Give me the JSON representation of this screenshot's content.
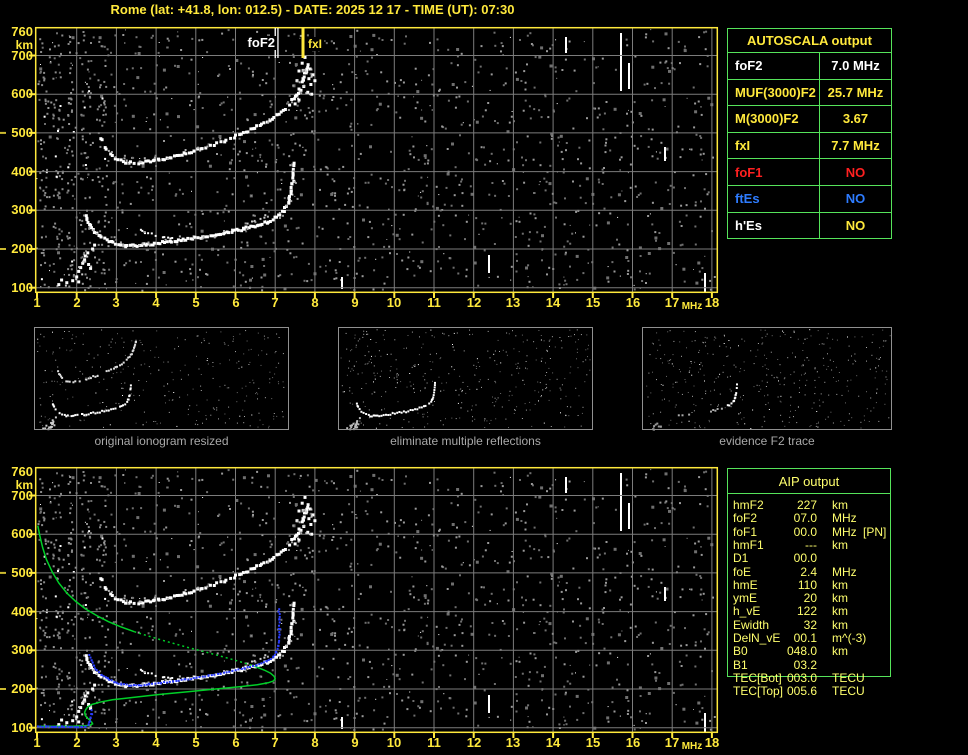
{
  "title": "Rome (lat: +41.8, lon: 012.5) - DATE: 2025 12 17 - TIME (UT): 07:30",
  "colors": {
    "background": "#000000",
    "yellow": "#FFE93C",
    "pale_yellow": "#FFFF6E",
    "white": "#FFFFFF",
    "red": "#FF2020",
    "blue": "#2E7CFF",
    "trace_blue": "#2A3CFF",
    "profile_green": "#00D028",
    "table_green": "#55E35A",
    "grid_gray": "#7C7C7C",
    "thumb_border_gray": "#909090",
    "caption_gray": "#A8A8A8"
  },
  "chart_data": {
    "type": "scatter",
    "title": "Ionogram, Rome, 2025 12 17 07:30 UT",
    "xlabel": "MHz",
    "ylabel": "km",
    "xlim": [
      1,
      18
    ],
    "ylim": [
      100,
      760
    ],
    "axes": {
      "x_ticks": [
        "1",
        "2",
        "3",
        "4",
        "5",
        "6",
        "7",
        "8",
        "9",
        "10",
        "11",
        "12",
        "13",
        "14",
        "15",
        "16",
        "17",
        "18"
      ],
      "x_unit": "MHz",
      "y_ticks": [
        "760",
        "700",
        "600",
        "500",
        "400",
        "300",
        "200",
        "100"
      ],
      "y_unit": "km"
    },
    "markers": [
      {
        "name": "foF2",
        "label": "foF2",
        "freq": 7.0,
        "color": "white"
      },
      {
        "name": "fxI",
        "label": "fxI",
        "freq": 7.7,
        "color": "yellow"
      }
    ],
    "series": {
      "first_hop": [
        [
          2.2,
          287
        ],
        [
          2.28,
          268
        ],
        [
          2.38,
          252
        ],
        [
          2.5,
          240
        ],
        [
          2.65,
          230
        ],
        [
          2.82,
          222
        ],
        [
          3.0,
          216
        ],
        [
          3.2,
          213
        ],
        [
          3.45,
          213
        ],
        [
          3.7,
          215
        ],
        [
          4.0,
          219
        ],
        [
          4.3,
          223
        ],
        [
          4.6,
          227
        ],
        [
          4.9,
          231
        ],
        [
          5.2,
          236
        ],
        [
          5.5,
          241
        ],
        [
          5.8,
          247
        ],
        [
          6.1,
          254
        ],
        [
          6.4,
          262
        ],
        [
          6.7,
          271
        ],
        [
          6.9,
          280
        ],
        [
          7.05,
          290
        ],
        [
          7.18,
          303
        ],
        [
          7.28,
          320
        ],
        [
          7.35,
          345
        ],
        [
          7.4,
          375
        ],
        [
          7.43,
          405
        ],
        [
          7.45,
          430
        ]
      ],
      "first_hop_cusp": [
        [
          3.5,
          253
        ],
        [
          3.7,
          246
        ],
        [
          3.95,
          239
        ],
        [
          4.2,
          234
        ],
        [
          4.45,
          230
        ]
      ],
      "inner_branch": [
        [
          6.05,
          262
        ],
        [
          6.3,
          270
        ],
        [
          6.55,
          278
        ],
        [
          6.75,
          287
        ],
        [
          6.9,
          295
        ]
      ],
      "second_hop": [
        [
          2.55,
          492
        ],
        [
          2.68,
          465
        ],
        [
          2.82,
          448
        ],
        [
          3.0,
          435
        ],
        [
          3.2,
          428
        ],
        [
          3.45,
          426
        ],
        [
          3.7,
          428
        ],
        [
          4.0,
          433
        ],
        [
          4.3,
          440
        ],
        [
          4.6,
          448
        ],
        [
          4.9,
          457
        ],
        [
          5.2,
          466
        ],
        [
          5.5,
          476
        ],
        [
          5.8,
          488
        ],
        [
          6.1,
          500
        ],
        [
          6.4,
          514
        ],
        [
          6.7,
          530
        ],
        [
          6.95,
          546
        ],
        [
          7.15,
          562
        ],
        [
          7.35,
          582
        ],
        [
          7.5,
          602
        ],
        [
          7.6,
          622
        ],
        [
          7.68,
          645
        ],
        [
          7.75,
          668
        ],
        [
          7.8,
          688
        ]
      ],
      "spread_f": [
        [
          7.5,
          575
        ],
        [
          7.55,
          598
        ],
        [
          7.6,
          585
        ],
        [
          7.65,
          610
        ],
        [
          7.7,
          640
        ],
        [
          7.72,
          620
        ],
        [
          7.78,
          655
        ],
        [
          7.85,
          640
        ],
        [
          7.9,
          625
        ],
        [
          7.82,
          605
        ],
        [
          7.88,
          665
        ],
        [
          7.95,
          650
        ],
        [
          7.6,
          660
        ],
        [
          7.68,
          680
        ],
        [
          7.75,
          695
        ],
        [
          7.55,
          635
        ],
        [
          8.0,
          635
        ],
        [
          7.92,
          600
        ]
      ],
      "e_region": [
        [
          1.62,
          120
        ],
        [
          1.75,
          113
        ],
        [
          1.9,
          118
        ],
        [
          2.0,
          128
        ],
        [
          2.05,
          142
        ],
        [
          2.1,
          152
        ],
        [
          2.15,
          163
        ],
        [
          2.2,
          172
        ],
        [
          2.22,
          182
        ],
        [
          2.28,
          190
        ],
        [
          2.05,
          115
        ],
        [
          2.3,
          160
        ],
        [
          2.35,
          150
        ],
        [
          1.55,
          108
        ],
        [
          2.4,
          200
        ],
        [
          2.45,
          210
        ]
      ],
      "profile_green": [
        [
          1.02,
          622
        ],
        [
          1.07,
          596
        ],
        [
          1.14,
          566
        ],
        [
          1.24,
          534
        ],
        [
          1.38,
          503
        ],
        [
          1.55,
          474
        ],
        [
          1.75,
          448
        ],
        [
          1.98,
          426
        ],
        [
          2.22,
          407
        ],
        [
          2.5,
          390
        ],
        [
          2.8,
          374
        ],
        [
          3.1,
          361
        ],
        [
          3.45,
          348
        ],
        [
          3.8,
          337
        ],
        [
          4.15,
          326
        ],
        [
          4.5,
          316
        ],
        [
          4.85,
          306
        ],
        [
          5.2,
          297
        ],
        [
          5.55,
          287
        ],
        [
          5.9,
          277
        ],
        [
          6.2,
          268
        ],
        [
          6.5,
          258
        ],
        [
          6.72,
          249
        ],
        [
          6.88,
          241
        ],
        [
          6.97,
          233
        ],
        [
          7.0,
          227
        ],
        [
          6.96,
          221
        ],
        [
          6.82,
          216
        ],
        [
          6.55,
          211
        ],
        [
          6.1,
          206
        ],
        [
          5.5,
          200
        ],
        [
          4.8,
          193
        ],
        [
          4.1,
          186
        ],
        [
          3.4,
          178
        ],
        [
          2.9,
          172
        ],
        [
          2.58,
          166
        ],
        [
          2.38,
          160
        ],
        [
          2.28,
          154
        ],
        [
          2.23,
          147
        ],
        [
          2.2,
          139
        ],
        [
          2.22,
          131
        ],
        [
          2.27,
          125
        ],
        [
          2.33,
          119
        ],
        [
          2.38,
          114
        ],
        [
          2.4,
          110
        ],
        [
          2.33,
          106
        ],
        [
          2.2,
          105
        ],
        [
          1.9,
          104
        ],
        [
          1.5,
          104
        ],
        [
          1.0,
          104
        ]
      ],
      "restored_E_blue": [
        [
          1.0,
          105
        ],
        [
          1.2,
          105
        ],
        [
          1.4,
          105
        ],
        [
          1.6,
          105
        ],
        [
          1.8,
          104
        ],
        [
          2.0,
          104
        ],
        [
          2.1,
          105
        ],
        [
          2.2,
          106
        ],
        [
          2.27,
          110
        ],
        [
          2.3,
          118
        ],
        [
          2.33,
          128
        ],
        [
          2.35,
          138
        ],
        [
          2.36,
          148
        ]
      ],
      "restored_F_blue": [
        [
          2.3,
          291
        ],
        [
          2.34,
          277
        ],
        [
          2.4,
          263
        ],
        [
          2.48,
          251
        ],
        [
          2.6,
          240
        ],
        [
          2.75,
          230
        ],
        [
          2.92,
          221
        ],
        [
          3.1,
          215
        ],
        [
          3.3,
          212
        ],
        [
          3.55,
          212
        ],
        [
          3.8,
          215
        ],
        [
          4.1,
          218
        ],
        [
          4.4,
          222
        ],
        [
          4.7,
          227
        ],
        [
          5.0,
          232
        ],
        [
          5.3,
          237
        ],
        [
          5.6,
          243
        ],
        [
          5.9,
          249
        ],
        [
          6.2,
          256
        ],
        [
          6.5,
          264
        ],
        [
          6.75,
          274
        ],
        [
          6.92,
          285
        ],
        [
          7.0,
          298
        ],
        [
          7.05,
          315
        ],
        [
          7.07,
          335
        ],
        [
          7.08,
          358
        ],
        [
          7.08,
          382
        ],
        [
          7.07,
          410
        ]
      ]
    }
  },
  "autoscala_table": {
    "title": "AUTOSCALA output",
    "rows": [
      {
        "param": "foF2",
        "value": "7.0 MHz",
        "color": "white"
      },
      {
        "param": "MUF(3000)F2",
        "value": "25.7 MHz",
        "color": "yellow"
      },
      {
        "param": "M(3000)F2",
        "value": "3.67",
        "color": "yellow"
      },
      {
        "param": "fxI",
        "value": "7.7 MHz",
        "color": "yellow"
      },
      {
        "param": "foF1",
        "value": "NO",
        "color": "red"
      },
      {
        "param": "ftEs",
        "value": "NO",
        "color": "blue"
      },
      {
        "param": "h'Es",
        "value": "NO",
        "color": "white",
        "value_color": "yellow"
      }
    ]
  },
  "aip_table": {
    "title": "AIP output",
    "rows": [
      {
        "param": "hmF2",
        "value": "227",
        "unit": "km",
        "extra": ""
      },
      {
        "param": "foF2",
        "value": "07.0",
        "unit": "MHz",
        "extra": ""
      },
      {
        "param": "foF1",
        "value": "00.0",
        "unit": "MHz",
        "extra": "[PN]"
      },
      {
        "param": "hmF1",
        "value": "---",
        "unit": "km",
        "extra": ""
      },
      {
        "param": "D1",
        "value": "00.0",
        "unit": "",
        "extra": ""
      },
      {
        "param": "foE",
        "value": "2.4",
        "unit": "MHz",
        "extra": ""
      },
      {
        "param": "hmE",
        "value": "110",
        "unit": "km",
        "extra": ""
      },
      {
        "param": "ymE",
        "value": "20",
        "unit": "km",
        "extra": ""
      },
      {
        "param": "h_vE",
        "value": "122",
        "unit": "km",
        "extra": ""
      },
      {
        "param": "Ewidth",
        "value": "32",
        "unit": "km",
        "extra": ""
      },
      {
        "param": "DelN_vE",
        "value": "00.1",
        "unit": "m^(-3)",
        "extra": ""
      },
      {
        "param": "B0",
        "value": "048.0",
        "unit": "km",
        "extra": ""
      },
      {
        "param": "B1",
        "value": "03.2",
        "unit": "",
        "extra": ""
      },
      {
        "param": "TEC[Bot]",
        "value": "003.0",
        "unit": "TECU",
        "extra": ""
      },
      {
        "param": "TEC[Top]",
        "value": "005.6",
        "unit": "TECU",
        "extra": ""
      }
    ]
  },
  "thumbnails": [
    {
      "caption": "original ionogram resized"
    },
    {
      "caption": "eliminate multiple reflections"
    },
    {
      "caption": "evidence F2 trace"
    }
  ]
}
